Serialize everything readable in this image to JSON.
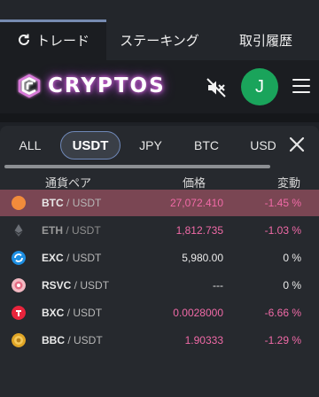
{
  "nav": {
    "tabs": [
      {
        "label": "トレード",
        "icon": "refresh-icon"
      },
      {
        "label": "ステーキング"
      },
      {
        "label": "取引履歴"
      }
    ]
  },
  "header": {
    "logo_text": "CRYPTOS",
    "avatar_letter": "J"
  },
  "currency_tabs": [
    "ALL",
    "USDT",
    "JPY",
    "BTC",
    "USD"
  ],
  "table": {
    "headers": {
      "pair": "通貨ペア",
      "price": "価格",
      "change": "変動"
    },
    "rows": [
      {
        "base": "BTC",
        "sep": " / ",
        "quote": "USDT",
        "price": "27,072.410",
        "change": "-1.45 %",
        "coin_color": "#f18b3b"
      },
      {
        "base": "ETH",
        "sep": " / ",
        "quote": "USDT",
        "price": "1,812.735",
        "change": "-1.03 %",
        "coin_color": "#6b6f76"
      },
      {
        "base": "EXC",
        "sep": " / ",
        "quote": "USDT",
        "price": "5,980.00",
        "change": "0 %",
        "coin_color": "#1d8fe3"
      },
      {
        "base": "RSVC",
        "sep": " / ",
        "quote": "USDT",
        "price": "---",
        "change": "0 %",
        "coin_color": "#f3b9c2"
      },
      {
        "base": "BXC",
        "sep": " / ",
        "quote": "USDT",
        "price": "0.0028000",
        "change": "-6.66 %",
        "coin_color": "#e8243c"
      },
      {
        "base": "BBC",
        "sep": " / ",
        "quote": "USDT",
        "price": "1.90333",
        "change": "-1.29 %",
        "coin_color": "#e0a526"
      }
    ]
  },
  "colors": {
    "accent": "#8fa7d6",
    "negative": "#f06aa7",
    "selected_row": "#7a4653",
    "avatar": "#1aa45b"
  }
}
